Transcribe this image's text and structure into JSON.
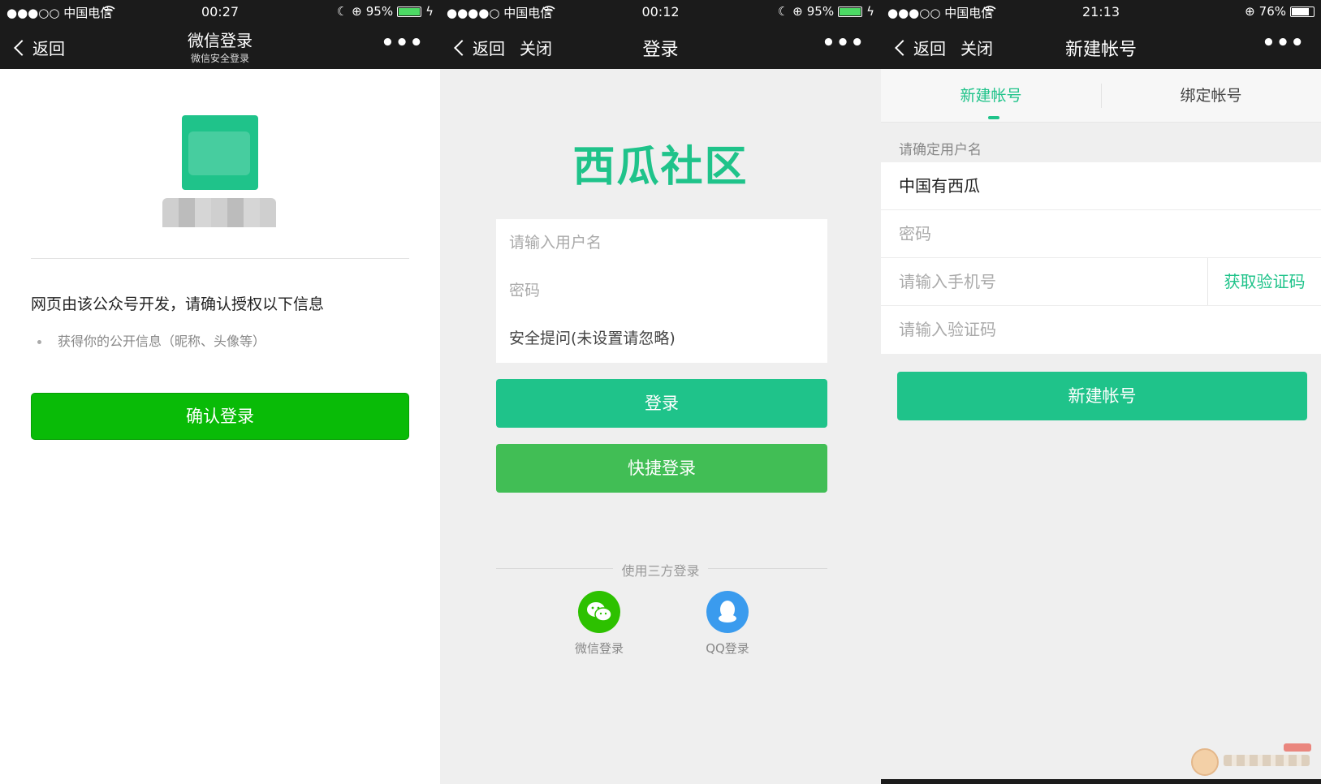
{
  "screens": [
    {
      "status": {
        "signal": "●●●○○ 中国电信",
        "time": "00:27",
        "battery": "95%"
      },
      "nav": {
        "back": "返回",
        "title": "微信登录",
        "subtitle": "微信安全登录",
        "more": "•••"
      },
      "auth": {
        "title": "网页由该公众号开发，请确认授权以下信息",
        "item": "获得你的公开信息（昵称、头像等）"
      },
      "confirm_button": "确认登录"
    },
    {
      "status": {
        "signal": "●●●●○ 中国电信",
        "time": "00:12",
        "battery": "95%"
      },
      "nav": {
        "back": "返回",
        "close": "关闭",
        "title": "登录",
        "more": "•••"
      },
      "brand": "西瓜社区",
      "fields": {
        "username_placeholder": "请输入用户名",
        "password_placeholder": "密码",
        "security": "安全提问(未设置请忽略)"
      },
      "login_button": "登录",
      "quick_button": "快捷登录",
      "third_party": {
        "title": "使用三方登录",
        "wechat": "微信登录",
        "qq": "QQ登录"
      }
    },
    {
      "status": {
        "signal": "●●●○○ 中国电信",
        "time": "21:13",
        "battery": "76%"
      },
      "nav": {
        "back": "返回",
        "close": "关闭",
        "title": "新建帐号",
        "more": "•••"
      },
      "tabs": [
        "新建帐号",
        "绑定帐号"
      ],
      "username_label": "请确定用户名",
      "fields": {
        "username_value": "中国有西瓜",
        "password_placeholder": "密码",
        "phone_placeholder": "请输入手机号",
        "get_code": "获取验证码",
        "code_placeholder": "请输入验证码"
      },
      "create_button": "新建帐号"
    }
  ],
  "colors": {
    "accent": "#1fc38a",
    "wechat_green": "#09bb07",
    "quick_green": "#41be55",
    "qq_blue": "#3a9bee",
    "nav_bg": "#1b1b1b"
  },
  "icons": {
    "signal": "signal-dots-icon",
    "wifi": "wifi-icon",
    "moon": "moon-icon",
    "lock_rotation": "rotation-lock-icon",
    "battery": "battery-icon",
    "back": "chevron-left-icon",
    "more": "more-dots-icon",
    "wechat": "wechat-icon",
    "qq": "qq-icon"
  },
  "battery_levels": [
    0.95,
    0.95,
    0.76
  ]
}
